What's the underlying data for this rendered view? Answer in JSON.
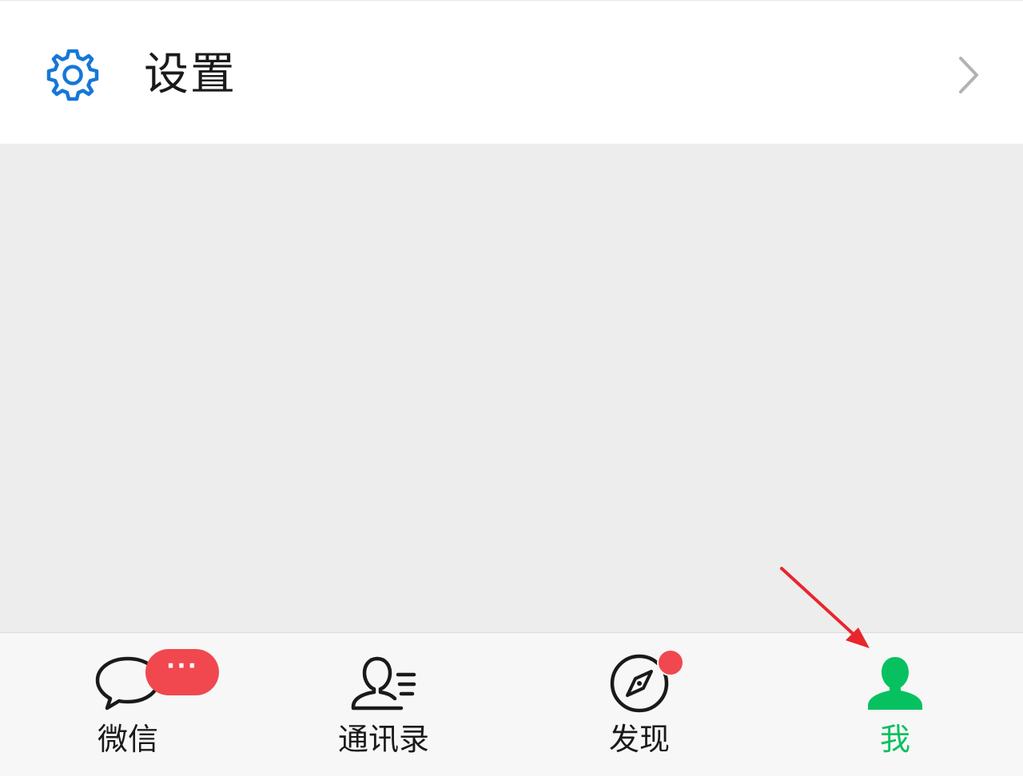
{
  "settings": {
    "label": "设置",
    "icon": "gear-icon",
    "chevron_icon": "chevron-right-icon",
    "icon_color": "#1677d7"
  },
  "tabbar": {
    "tabs": [
      {
        "id": "chats",
        "label": "微信",
        "icon": "chat-bubble-icon",
        "active": false,
        "badge": "···"
      },
      {
        "id": "contacts",
        "label": "通讯录",
        "icon": "contacts-icon",
        "active": false
      },
      {
        "id": "discover",
        "label": "发现",
        "icon": "compass-icon",
        "active": false,
        "dot": true
      },
      {
        "id": "me",
        "label": "我",
        "icon": "person-icon",
        "active": true
      }
    ],
    "active_color": "#07c160",
    "badge_color": "#f0484e"
  },
  "annotation": {
    "arrow_color": "#e8262b"
  }
}
